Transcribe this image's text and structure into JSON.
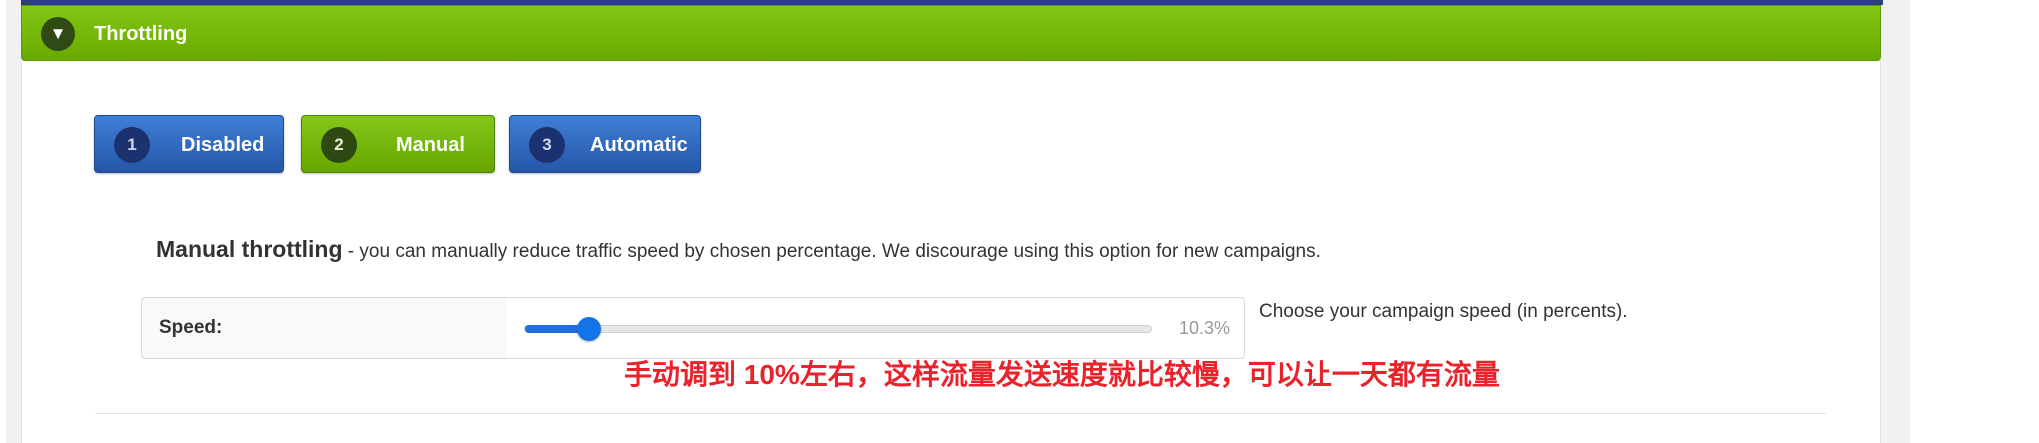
{
  "panel": {
    "title": "Throttling",
    "collapse_glyph": "▼"
  },
  "modes": [
    {
      "number": "1",
      "label": "Disabled",
      "state": "inactive",
      "color": "#2f67c0"
    },
    {
      "number": "2",
      "label": "Manual",
      "state": "active",
      "color": "#76b80b"
    },
    {
      "number": "3",
      "label": "Automatic",
      "state": "inactive",
      "color": "#2f67c0"
    }
  ],
  "description": {
    "heading": "Manual throttling",
    "text": " - you can manually reduce traffic speed by chosen percentage. We discourage using this option for new campaigns."
  },
  "speed": {
    "label": "Speed:",
    "value_text": "10.3%",
    "value": 10.3,
    "help": "Choose your campaign speed (in percents)."
  },
  "annotation": {
    "text": "手动调到 10%左右，这样流量发送速度就比较慢，可以让一天都有流量",
    "color": "#e8232c"
  },
  "colors": {
    "accent_green": "#76b80b",
    "accent_blue": "#2f67c0",
    "slider_blue": "#1473e6"
  }
}
